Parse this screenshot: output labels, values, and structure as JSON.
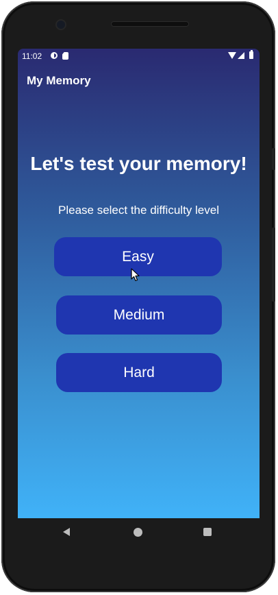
{
  "status_bar": {
    "time": "11:02",
    "icons": [
      "data-saver-icon",
      "sd-card-icon",
      "wifi-icon",
      "signal-icon",
      "battery-icon"
    ]
  },
  "app_bar": {
    "title": "My Memory"
  },
  "main": {
    "headline": "Let's test your memory!",
    "subtitle": "Please select the difficulty level",
    "buttons": {
      "easy": "Easy",
      "medium": "Medium",
      "hard": "Hard"
    }
  },
  "nav_bar": {
    "icons": [
      "back-icon",
      "home-icon",
      "recents-icon"
    ]
  },
  "colors": {
    "gradient_top": "#2a2a71",
    "gradient_bottom": "#40b2f8",
    "button": "#1f36b0",
    "text": "#ffffff"
  }
}
